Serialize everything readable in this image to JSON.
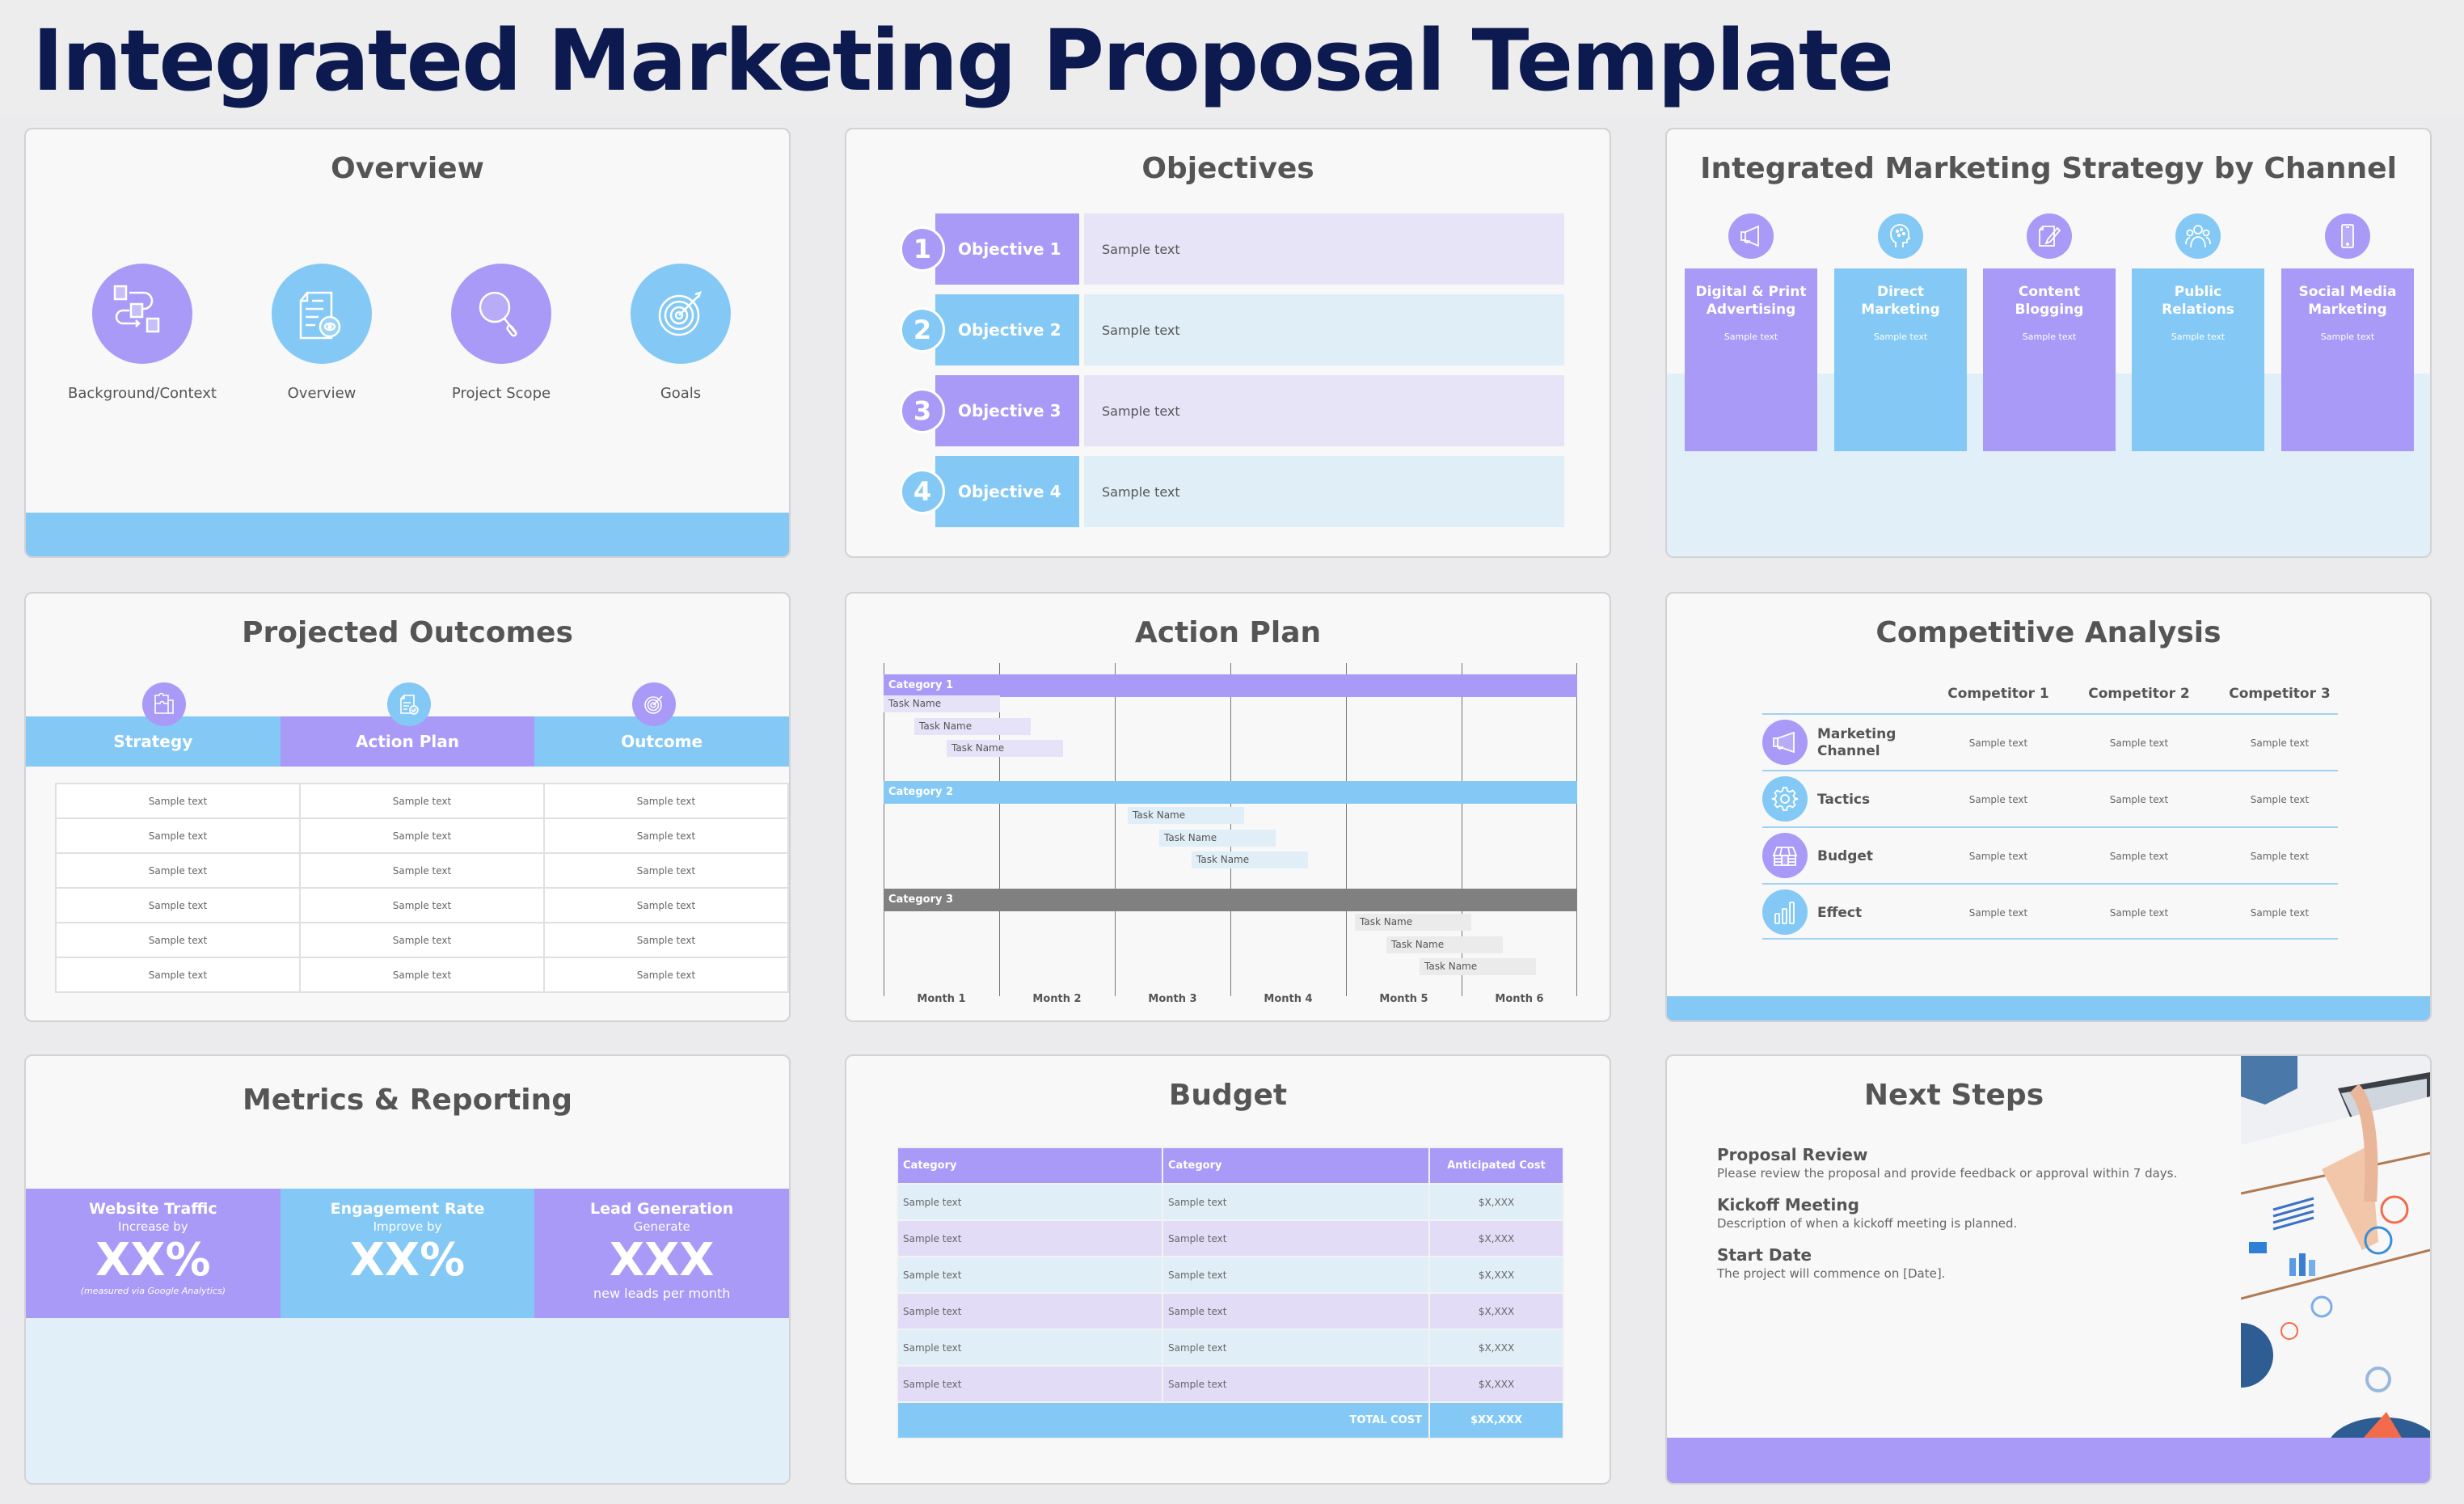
{
  "page": {
    "title": "Integrated Marketing Proposal Template"
  },
  "colors": {
    "purple": "#a99af7",
    "blue": "#84c9f5",
    "navy": "#0d1a4f",
    "light_purple": "#e7e4f7",
    "light_blue": "#e0eef8",
    "gray": "#808080"
  },
  "overview": {
    "title": "Overview",
    "items": [
      {
        "label": "Background/Context",
        "icon": "flowchart-icon"
      },
      {
        "label": "Overview",
        "icon": "document-eye-icon"
      },
      {
        "label": "Project Scope",
        "icon": "magnifier-icon"
      },
      {
        "label": "Goals",
        "icon": "target-icon"
      }
    ]
  },
  "objectives": {
    "title": "Objectives",
    "items": [
      {
        "num": "1",
        "label": "Objective 1",
        "text": "Sample text"
      },
      {
        "num": "2",
        "label": "Objective 2",
        "text": "Sample text"
      },
      {
        "num": "3",
        "label": "Objective 3",
        "text": "Sample text"
      },
      {
        "num": "4",
        "label": "Objective 4",
        "text": "Sample text"
      }
    ]
  },
  "strategy": {
    "title": "Integrated Marketing Strategy by Channel",
    "channels": [
      {
        "name_line1": "Digital & Print",
        "name_line2": "Advertising",
        "text": "Sample text",
        "icon": "megaphone-icon"
      },
      {
        "name_line1": "Direct",
        "name_line2": "Marketing",
        "text": "Sample text",
        "icon": "head-brain-icon"
      },
      {
        "name_line1": "Content",
        "name_line2": "Blogging",
        "text": "Sample text",
        "icon": "pencil-page-icon"
      },
      {
        "name_line1": "Public",
        "name_line2": "Relations",
        "text": "Sample text",
        "icon": "people-group-icon"
      },
      {
        "name_line1": "Social Media",
        "name_line2": "Marketing",
        "text": "Sample text",
        "icon": "smartphone-icon"
      }
    ]
  },
  "outcomes": {
    "title": "Projected Outcomes",
    "headers": [
      "Strategy",
      "Action Plan",
      "Outcome"
    ],
    "rows": [
      [
        "Sample text",
        "Sample text",
        "Sample text"
      ],
      [
        "Sample text",
        "Sample text",
        "Sample text"
      ],
      [
        "Sample text",
        "Sample text",
        "Sample text"
      ],
      [
        "Sample text",
        "Sample text",
        "Sample text"
      ],
      [
        "Sample text",
        "Sample text",
        "Sample text"
      ],
      [
        "Sample text",
        "Sample text",
        "Sample text"
      ]
    ]
  },
  "action_plan": {
    "title": "Action Plan",
    "months": [
      "Month 1",
      "Month 2",
      "Month 3",
      "Month 4",
      "Month 5",
      "Month 6"
    ],
    "categories": [
      {
        "name": "Category 1",
        "tasks": [
          "Task Name",
          "Task Name",
          "Task Name"
        ]
      },
      {
        "name": "Category 2",
        "tasks": [
          "Task Name",
          "Task Name",
          "Task Name"
        ]
      },
      {
        "name": "Category 3",
        "tasks": [
          "Task Name",
          "Task Name",
          "Task Name"
        ]
      }
    ]
  },
  "competitive": {
    "title": "Competitive Analysis",
    "competitors": [
      "Competitor 1",
      "Competitor 2",
      "Competitor 3"
    ],
    "rows": [
      {
        "label_line1": "Marketing",
        "label_line2": "Channel",
        "cells": [
          "Sample text",
          "Sample text",
          "Sample text"
        ]
      },
      {
        "label_line1": "Tactics",
        "label_line2": "",
        "cells": [
          "Sample text",
          "Sample text",
          "Sample text"
        ]
      },
      {
        "label_line1": "Budget",
        "label_line2": "",
        "cells": [
          "Sample text",
          "Sample text",
          "Sample text"
        ]
      },
      {
        "label_line1": "Effect",
        "label_line2": "",
        "cells": [
          "Sample text",
          "Sample text",
          "Sample text"
        ]
      }
    ]
  },
  "metrics": {
    "title": "Metrics & Reporting",
    "items": [
      {
        "name": "Website Traffic",
        "sub": "Increase by",
        "value": "XX%",
        "note": "(measured via Google Analytics)"
      },
      {
        "name": "Engagement Rate",
        "sub": "Improve by",
        "value": "XX%",
        "note": ""
      },
      {
        "name": "Lead Generation",
        "sub": "Generate",
        "value": "XXX",
        "note": "new leads per month"
      }
    ]
  },
  "budget": {
    "title": "Budget",
    "headers": [
      "Category",
      "Category",
      "Anticipated Cost"
    ],
    "rows": [
      [
        "Sample text",
        "Sample text",
        "$X,XXX"
      ],
      [
        "Sample text",
        "Sample text",
        "$X,XXX"
      ],
      [
        "Sample text",
        "Sample text",
        "$X,XXX"
      ],
      [
        "Sample text",
        "Sample text",
        "$X,XXX"
      ],
      [
        "Sample text",
        "Sample text",
        "$X,XXX"
      ],
      [
        "Sample text",
        "Sample text",
        "$X,XXX"
      ]
    ],
    "total_label": "TOTAL COST",
    "total_value": "$XX,XXX"
  },
  "next_steps": {
    "title": "Next Steps",
    "items": [
      {
        "heading": "Proposal Review",
        "desc": "Please review the proposal and provide feedback or approval within 7 days."
      },
      {
        "heading": "Kickoff Meeting",
        "desc": "Description of when a kickoff meeting is planned."
      },
      {
        "heading": "Start Date",
        "desc": "The project will commence on [Date]."
      }
    ]
  }
}
